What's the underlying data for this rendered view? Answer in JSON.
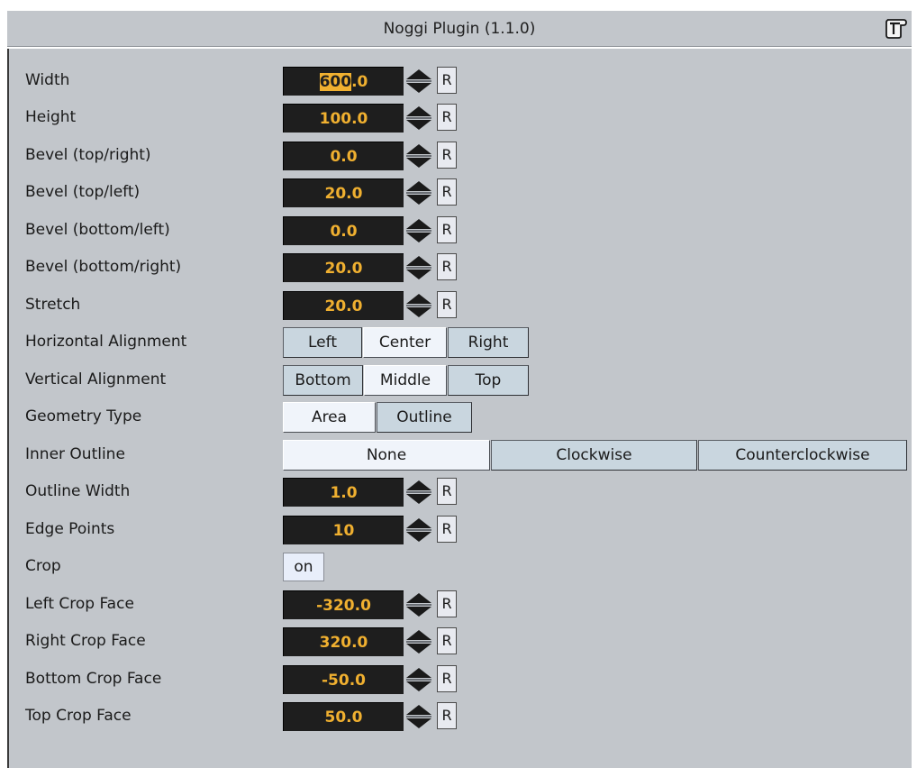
{
  "plugin": {
    "title": "Noggi Plugin (1.1.0)",
    "icon": "plugin-script-icon"
  },
  "fields": [
    {
      "key": "width",
      "label": "Width",
      "value_sel": "600",
      "value_rest": ".0",
      "reset": "R"
    },
    {
      "key": "height",
      "label": "Height",
      "value": "100.0",
      "reset": "R"
    },
    {
      "key": "bevel-top-right",
      "label": "Bevel (top/right)",
      "value": "0.0",
      "reset": "R"
    },
    {
      "key": "bevel-top-left",
      "label": "Bevel (top/left)",
      "value": "20.0",
      "reset": "R"
    },
    {
      "key": "bevel-bottom-left",
      "label": "Bevel (bottom/left)",
      "value": "0.0",
      "reset": "R"
    },
    {
      "key": "bevel-bottom-right",
      "label": "Bevel (bottom/right)",
      "value": "20.0",
      "reset": "R"
    },
    {
      "key": "stretch",
      "label": "Stretch",
      "value": "20.0",
      "reset": "R"
    }
  ],
  "horizontal_alignment": {
    "label": "Horizontal Alignment",
    "options": [
      "Left",
      "Center",
      "Right"
    ],
    "selected": "Center"
  },
  "vertical_alignment": {
    "label": "Vertical Alignment",
    "options": [
      "Bottom",
      "Middle",
      "Top"
    ],
    "selected": "Middle"
  },
  "geometry_type": {
    "label": "Geometry Type",
    "options": [
      "Area",
      "Outline"
    ],
    "selected": "Area"
  },
  "inner_outline": {
    "label": "Inner Outline",
    "options": [
      "None",
      "Clockwise",
      "Counterclockwise"
    ],
    "selected": "None"
  },
  "fields2": [
    {
      "key": "outline-width",
      "label": "Outline Width",
      "value": "1.0",
      "reset": "R"
    },
    {
      "key": "edge-points",
      "label": "Edge Points",
      "value": "10",
      "reset": "R"
    }
  ],
  "crop": {
    "label": "Crop",
    "value": "on"
  },
  "fields3": [
    {
      "key": "left-crop-face",
      "label": "Left Crop Face",
      "value": "-320.0",
      "reset": "R"
    },
    {
      "key": "right-crop-face",
      "label": "Right Crop Face",
      "value": "320.0",
      "reset": "R"
    },
    {
      "key": "bottom-crop-face",
      "label": "Bottom Crop Face",
      "value": "-50.0",
      "reset": "R"
    },
    {
      "key": "top-crop-face",
      "label": "Top Crop Face",
      "value": "50.0",
      "reset": "R"
    }
  ]
}
